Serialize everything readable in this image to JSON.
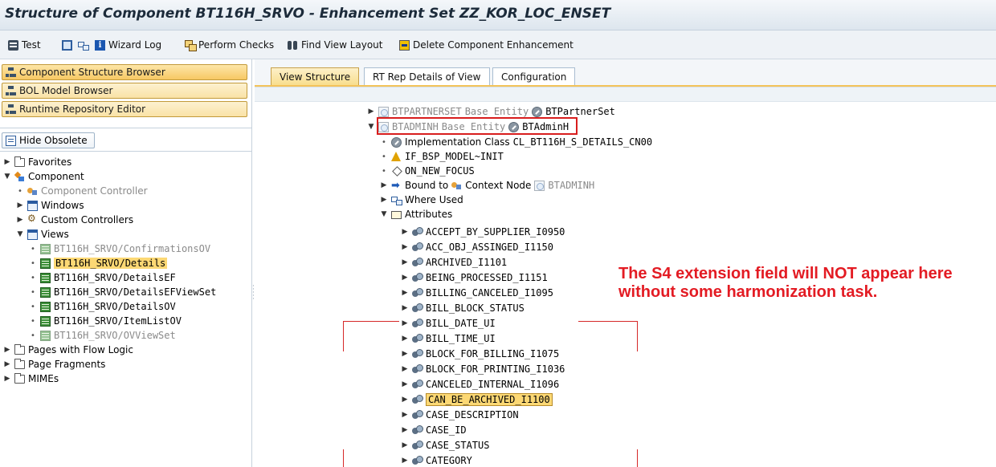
{
  "title": "Structure of Component BT116H_SRVO - Enhancement Set ZZ_KOR_LOC_ENSET",
  "toolbar": {
    "test": "Test",
    "wizard_log": "Wizard Log",
    "perform_checks": "Perform Checks",
    "find_view_layout": "Find View Layout",
    "delete_enhancement": "Delete Component Enhancement"
  },
  "nav": {
    "component_structure_browser": "Component Structure Browser",
    "bol_model_browser": "BOL Model Browser",
    "runtime_repository_editor": "Runtime Repository Editor",
    "hide_obsolete": "Hide Obsolete"
  },
  "tree": {
    "favorites": "Favorites",
    "component": "Component",
    "component_controller": "Component Controller",
    "windows": "Windows",
    "custom_controllers": "Custom Controllers",
    "views": "Views",
    "view_items": [
      "BT116H_SRVO/ConfirmationsOV",
      "BT116H_SRVO/Details",
      "BT116H_SRVO/DetailsEF",
      "BT116H_SRVO/DetailsEFViewSet",
      "BT116H_SRVO/DetailsOV",
      "BT116H_SRVO/ItemListOV",
      "BT116H_SRVO/OVViewSet"
    ],
    "pages_with_flow_logic": "Pages with Flow Logic",
    "page_fragments": "Page Fragments",
    "mimes": "MIMEs"
  },
  "tabs": [
    "View Structure",
    "RT Rep Details of View",
    "Configuration"
  ],
  "structure": {
    "entity1_name": "BTPARTNERSET",
    "entity1_type": "Base Entity",
    "entity1_obj": "BTPartnerSet",
    "entity2_name": "BTADMINH",
    "entity2_type": "Base Entity",
    "entity2_obj": "BTAdminH",
    "impl_class_label": "Implementation Class",
    "impl_class": "CL_BT116H_S_DETAILS_CN00",
    "if_init": "IF_BSP_MODEL~INIT",
    "on_new_focus": "ON_NEW_FOCUS",
    "bound_to": "Bound to",
    "context_node_label": "Context Node",
    "context_node": "BTADMINH",
    "where_used": "Where Used",
    "attributes_label": "Attributes",
    "attributes": [
      "ACCEPT_BY_SUPPLIER_I0950",
      "ACC_OBJ_ASSINGED_I1150",
      "ARCHIVED_I1101",
      "BEING_PROCESSED_I1151",
      "BILLING_CANCELED_I1095",
      "BILL_BLOCK_STATUS",
      "BILL_DATE_UI",
      "BILL_TIME_UI",
      "BLOCK_FOR_BILLING_I1075",
      "BLOCK_FOR_PRINTING_I1036",
      "CANCELED_INTERNAL_I1096",
      "CAN_BE_ARCHIVED_I1100",
      "CASE_DESCRIPTION",
      "CASE_ID",
      "CASE_STATUS",
      "CATEGORY"
    ]
  },
  "annotation": "The S4 extension field will NOT appear here without some harmonization task.",
  "colors": {
    "annotation_red": "#e31b23",
    "selection_yellow": "#fcd874",
    "nav_button_orange": "#f7c863"
  }
}
